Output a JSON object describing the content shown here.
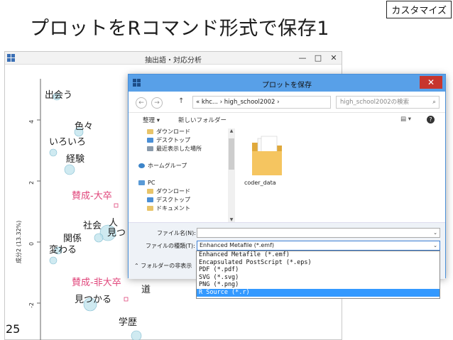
{
  "slide": {
    "title": "プロットをRコマンド形式で保存1",
    "tag": "カスタマイズ",
    "page_number": "25"
  },
  "bg_window": {
    "title": "抽出語・対応分析",
    "buttons": [
      "—",
      "□",
      "✕"
    ]
  },
  "plot": {
    "y_axis_label": "成分2 (13.32%)",
    "y_ticks": [
      "4",
      "2",
      "0",
      "-2"
    ],
    "words": [
      {
        "text": "出会う",
        "color": "#1d1d1d"
      },
      {
        "text": "色々",
        "color": "#1d1d1d"
      },
      {
        "text": "いろいろ",
        "color": "#1d1d1d"
      },
      {
        "text": "経験",
        "color": "#1d1d1d"
      },
      {
        "text": "賛成-大卒",
        "color": "#e0467b"
      },
      {
        "text": "社会",
        "color": "#1d1d1d"
      },
      {
        "text": "人",
        "color": "#1d1d1d"
      },
      {
        "text": "見つ",
        "color": "#1d1d1d"
      },
      {
        "text": "関係",
        "color": "#1d1d1d"
      },
      {
        "text": "変わる",
        "color": "#1d1d1d"
      },
      {
        "text": "賛成-非大卒",
        "color": "#e0467b"
      },
      {
        "text": "見つかる",
        "color": "#1d1d1d"
      },
      {
        "text": "道",
        "color": "#1d1d1d"
      },
      {
        "text": "学歴",
        "color": "#1d1d1d"
      }
    ]
  },
  "dialog": {
    "title": "プロットを保存",
    "close": "✕",
    "address": "« khc... › high_school2002 ›",
    "search_placeholder": "high_school2002の検索",
    "toolbar": {
      "organize": "整理 ▾",
      "new_folder": "新しいフォルダー"
    },
    "nav_items": [
      {
        "label": "ダウンロード",
        "indent": true
      },
      {
        "label": "デスクトップ",
        "indent": true
      },
      {
        "label": "最近表示した場所",
        "indent": true
      },
      {
        "label": "",
        "indent": false
      },
      {
        "label": "ホームグループ",
        "indent": false
      },
      {
        "label": "",
        "indent": false
      },
      {
        "label": "PC",
        "indent": false
      },
      {
        "label": "ダウンロード",
        "indent": true
      },
      {
        "label": "デスクトップ",
        "indent": true
      },
      {
        "label": "ドキュメント",
        "indent": true
      }
    ],
    "folder_name": "coder_data",
    "filename_label": "ファイル名(N):",
    "filename_value": "",
    "filetype_label": "ファイルの種類(T):",
    "filetype_value": "Enhanced Metafile (*.emf)",
    "hide_folders": "フォルダーの非表示",
    "filetype_options": [
      "Enhanced Metafile (*.emf)",
      "Encapsulated PostScript (*.eps)",
      "PDF (*.pdf)",
      "SVG (*.svg)",
      "PNG (*.png)",
      "R Source (*.r)"
    ],
    "selected_option_index": 5
  }
}
